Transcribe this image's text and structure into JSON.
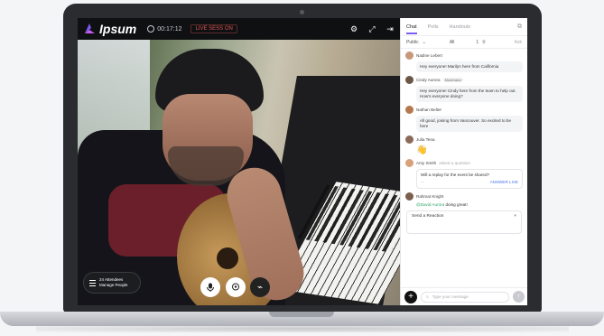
{
  "app": {
    "logo_text": "Ipsum",
    "time": "00:17:12",
    "live_label": "LIVE SESS ON"
  },
  "panel": {
    "tabs": [
      "Chat",
      "Polls",
      "Handouts"
    ],
    "filter": {
      "scope": "Public",
      "all": "All",
      "count": "1",
      "ask": "Ask"
    },
    "messages": [
      {
        "name": "Nadine Lebert",
        "text": "Hey everyone! Marilyn here from California"
      },
      {
        "name": "Cindy Aurora",
        "role": "Moderator",
        "text": "Hey everyone! Cindy here from the team to help out. How's everyone doing?"
      },
      {
        "name": "Nathan Belter",
        "text": "All good, joining from Vancouver. So excited to be here"
      },
      {
        "name": "Julia Tena",
        "emoji": "👋"
      },
      {
        "name": "Amy Smith",
        "meta": "asked a question",
        "question": "Will a replay for the event be shared?",
        "answer": "ANSWER LIVE"
      },
      {
        "name": "Rahmat Knight",
        "mention": "@David Aurora",
        "text": "doing great!"
      }
    ],
    "reaction": {
      "label": "Send a Reaction",
      "close": "×"
    },
    "composer": {
      "placeholder": "Type your message"
    }
  },
  "video": {
    "attendees_count": "24 Attendees",
    "attendees_sub": "Manage People"
  }
}
